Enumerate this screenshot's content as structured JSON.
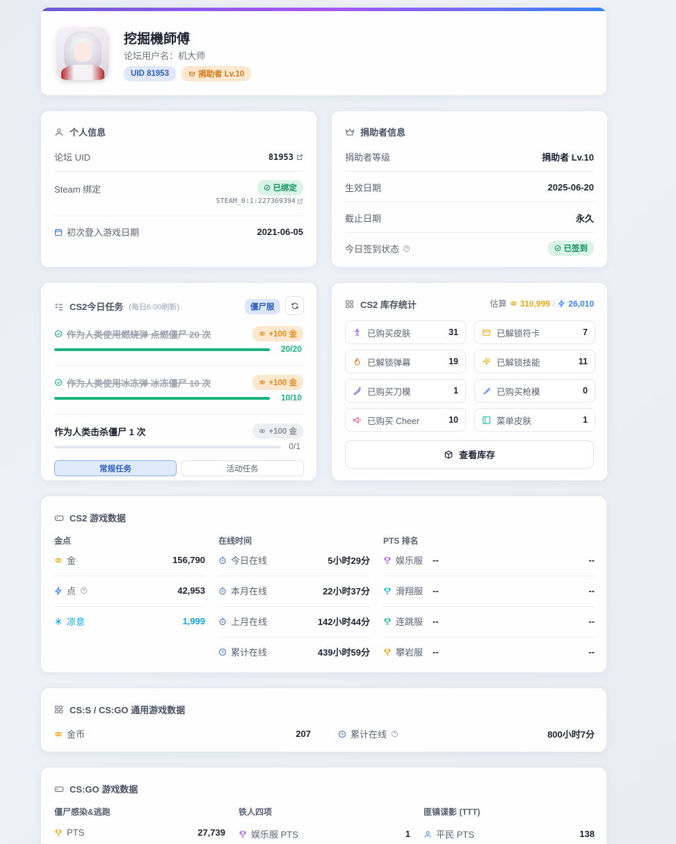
{
  "profile": {
    "name": "挖掘機師傅",
    "username_label": "论坛用户名：",
    "username": "机大师",
    "uid_tag": "UID 81953",
    "donor_tag": "捐助者 Lv.10"
  },
  "personal": {
    "title": "个人信息",
    "uid_label": "论坛 UID",
    "uid_value": "81953",
    "steam_label": "Steam 绑定",
    "steam_status": "已绑定",
    "steam_id": "STEAM_0:1:227369394",
    "first_login_label": "初次登入游戏日期",
    "first_login_value": "2021-06-05"
  },
  "donor": {
    "title": "捐助者信息",
    "level_label": "捐助者等级",
    "level_value": "捐助者 Lv.10",
    "start_label": "生效日期",
    "start_value": "2025-06-20",
    "end_label": "截止日期",
    "end_value": "永久",
    "checkin_label": "今日签到状态",
    "checkin_value": "已签到"
  },
  "tasks": {
    "title": "CS2今日任务",
    "refresh_note": "(每日6:00刷新)",
    "server_badge": "僵尸服",
    "items": [
      {
        "title": "作为人类使用燃烧弹 点燃僵尸 20 次",
        "reward": "+100 金",
        "progress": "20/20",
        "fraction": 1.0
      },
      {
        "title": "作为人类使用冰冻弹 冰冻僵尸 10 次",
        "reward": "+100 金",
        "progress": "10/10",
        "fraction": 1.0
      },
      {
        "title": "作为人类击杀僵尸 1 次",
        "reward": "+100 金",
        "progress": "0/1",
        "fraction": 0.0
      }
    ],
    "tab_regular": "常规任务",
    "tab_event": "活动任务"
  },
  "inventory": {
    "title": "CS2 库存统计",
    "estimate_label": "估算",
    "estimate_gold": "310,999",
    "estimate_sep": "/",
    "estimate_points": "26,010",
    "stats": [
      {
        "label": "已购买皮肤",
        "value": "31",
        "icon": "person-icon",
        "color": "#8b5cf6"
      },
      {
        "label": "已解锁符卡",
        "value": "7",
        "icon": "card-icon",
        "color": "#e6a91a"
      },
      {
        "label": "已解锁弹幕",
        "value": "19",
        "icon": "fire-icon",
        "color": "#f97316"
      },
      {
        "label": "已解锁技能",
        "value": "11",
        "icon": "sparkle-icon",
        "color": "#eab308"
      },
      {
        "label": "已购买刀模",
        "value": "1",
        "icon": "knife-icon",
        "color": "#6366f1"
      },
      {
        "label": "已购买枪模",
        "value": "0",
        "icon": "gun-icon",
        "color": "#3b82f6"
      },
      {
        "label": "已购买 Cheer",
        "value": "10",
        "icon": "megaphone-icon",
        "color": "#ec4899"
      },
      {
        "label": "菜单皮肤",
        "value": "1",
        "icon": "panel-icon",
        "color": "#14b8a6"
      }
    ],
    "view_button": "查看库存"
  },
  "cs2": {
    "title": "CS2 游戏数据",
    "gold_head": "金点",
    "time_head": "在线时间",
    "pts_head": "PTS 排名",
    "gold": [
      {
        "label": "金",
        "value": "156,790",
        "icon": "coin-icon",
        "color": "#e6a91a"
      },
      {
        "label": "点",
        "value": "42,953",
        "icon": "bolt-icon",
        "color": "#3b82f6"
      },
      {
        "label": "凉意",
        "value": "1,999",
        "icon": "snow-icon",
        "color": "#0ea5e9"
      }
    ],
    "time": [
      {
        "label": "今日在线",
        "value": "5小时29分"
      },
      {
        "label": "本月在线",
        "value": "22小时37分"
      },
      {
        "label": "上月在线",
        "value": "142小时44分"
      },
      {
        "label": "累计在线",
        "value": "439小时59分"
      }
    ],
    "pts": [
      {
        "label": "娱乐服",
        "rank": "--",
        "value": "--",
        "color": "#a855f7"
      },
      {
        "label": "滑翔服",
        "rank": "--",
        "value": "--",
        "color": "#06b6d4"
      },
      {
        "label": "连跳服",
        "rank": "--",
        "value": "--",
        "color": "#10b981"
      },
      {
        "label": "攀岩服",
        "rank": "--",
        "value": "--",
        "color": "#f59e0b"
      }
    ]
  },
  "csgo_common": {
    "title": "CS:S / CS:GO 通用游戏数据",
    "coin_label": "金币",
    "coin_value": "207",
    "online_label": "累计在线",
    "online_value": "800小时7分"
  },
  "csgo": {
    "title": "CS:GO 游戏数据",
    "col1_head": "僵尸感染&逃跑",
    "col2_head": "铁人四项",
    "col3_head": "匪镇谍影 (TTT)",
    "col1_label": "PTS",
    "col1_value": "27,739",
    "col2_label": "娱乐服 PTS",
    "col2_value": "1",
    "col3_label": "平民 PTS",
    "col3_value": "138"
  }
}
